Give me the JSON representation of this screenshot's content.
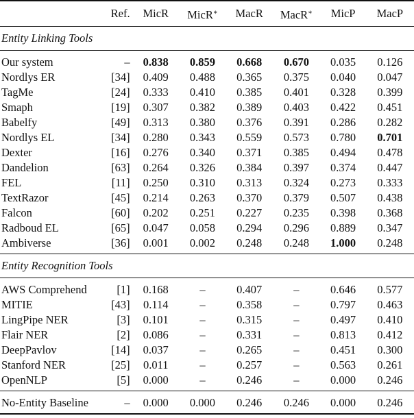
{
  "table": {
    "columns": [
      "",
      "Ref.",
      "MicR",
      "MicR*",
      "MacR",
      "MacR*",
      "MicP",
      "MacP"
    ],
    "sections": [
      {
        "title": "Entity Linking Tools",
        "rows": [
          {
            "name": "Our system",
            "ref": "–",
            "values": [
              "0.838",
              "0.859",
              "0.668",
              "0.670",
              "0.035",
              "0.126"
            ],
            "bold": [
              0,
              1,
              2,
              3
            ]
          },
          {
            "name": "Nordlys ER",
            "ref": "[34]",
            "values": [
              "0.409",
              "0.488",
              "0.365",
              "0.375",
              "0.040",
              "0.047"
            ],
            "bold": []
          },
          {
            "name": "TagMe",
            "ref": "[24]",
            "values": [
              "0.333",
              "0.410",
              "0.385",
              "0.401",
              "0.328",
              "0.399"
            ],
            "bold": []
          },
          {
            "name": "Smaph",
            "ref": "[19]",
            "values": [
              "0.307",
              "0.382",
              "0.389",
              "0.403",
              "0.422",
              "0.451"
            ],
            "bold": []
          },
          {
            "name": "Babelfy",
            "ref": "[49]",
            "values": [
              "0.313",
              "0.380",
              "0.376",
              "0.391",
              "0.286",
              "0.282"
            ],
            "bold": []
          },
          {
            "name": "Nordlys EL",
            "ref": "[34]",
            "values": [
              "0.280",
              "0.343",
              "0.559",
              "0.573",
              "0.780",
              "0.701"
            ],
            "bold": [
              5
            ]
          },
          {
            "name": "Dexter",
            "ref": "[16]",
            "values": [
              "0.276",
              "0.340",
              "0.371",
              "0.385",
              "0.494",
              "0.478"
            ],
            "bold": []
          },
          {
            "name": "Dandelion",
            "ref": "[63]",
            "values": [
              "0.264",
              "0.326",
              "0.384",
              "0.397",
              "0.374",
              "0.447"
            ],
            "bold": []
          },
          {
            "name": "FEL",
            "ref": "[11]",
            "values": [
              "0.250",
              "0.310",
              "0.313",
              "0.324",
              "0.273",
              "0.333"
            ],
            "bold": []
          },
          {
            "name": "TextRazor",
            "ref": "[45]",
            "values": [
              "0.214",
              "0.263",
              "0.370",
              "0.379",
              "0.507",
              "0.438"
            ],
            "bold": []
          },
          {
            "name": "Falcon",
            "ref": "[60]",
            "values": [
              "0.202",
              "0.251",
              "0.227",
              "0.235",
              "0.398",
              "0.368"
            ],
            "bold": []
          },
          {
            "name": "Radboud EL",
            "ref": "[65]",
            "values": [
              "0.047",
              "0.058",
              "0.294",
              "0.296",
              "0.889",
              "0.347"
            ],
            "bold": []
          },
          {
            "name": "Ambiverse",
            "ref": "[36]",
            "values": [
              "0.001",
              "0.002",
              "0.248",
              "0.248",
              "1.000",
              "0.248"
            ],
            "bold": [
              4
            ]
          }
        ]
      },
      {
        "title": "Entity Recognition Tools",
        "rows": [
          {
            "name": "AWS Comprehend",
            "ref": "[1]",
            "values": [
              "0.168",
              "–",
              "0.407",
              "–",
              "0.646",
              "0.577"
            ],
            "bold": []
          },
          {
            "name": "MITIE",
            "ref": "[43]",
            "values": [
              "0.114",
              "–",
              "0.358",
              "–",
              "0.797",
              "0.463"
            ],
            "bold": []
          },
          {
            "name": "LingPipe NER",
            "ref": "[3]",
            "values": [
              "0.101",
              "–",
              "0.315",
              "–",
              "0.497",
              "0.410"
            ],
            "bold": []
          },
          {
            "name": "Flair NER",
            "ref": "[2]",
            "values": [
              "0.086",
              "–",
              "0.331",
              "–",
              "0.813",
              "0.412"
            ],
            "bold": []
          },
          {
            "name": "DeepPavlov",
            "ref": "[14]",
            "values": [
              "0.037",
              "–",
              "0.265",
              "–",
              "0.451",
              "0.300"
            ],
            "bold": []
          },
          {
            "name": "Stanford NER",
            "ref": "[25]",
            "values": [
              "0.011",
              "–",
              "0.257",
              "–",
              "0.563",
              "0.261"
            ],
            "bold": []
          },
          {
            "name": "OpenNLP",
            "ref": "[5]",
            "values": [
              "0.000",
              "–",
              "0.246",
              "–",
              "0.000",
              "0.246"
            ],
            "bold": []
          }
        ]
      }
    ],
    "baseline": {
      "name": "No-Entity Baseline",
      "ref": "–",
      "values": [
        "0.000",
        "0.000",
        "0.246",
        "0.246",
        "0.000",
        "0.246"
      ],
      "bold": []
    }
  }
}
